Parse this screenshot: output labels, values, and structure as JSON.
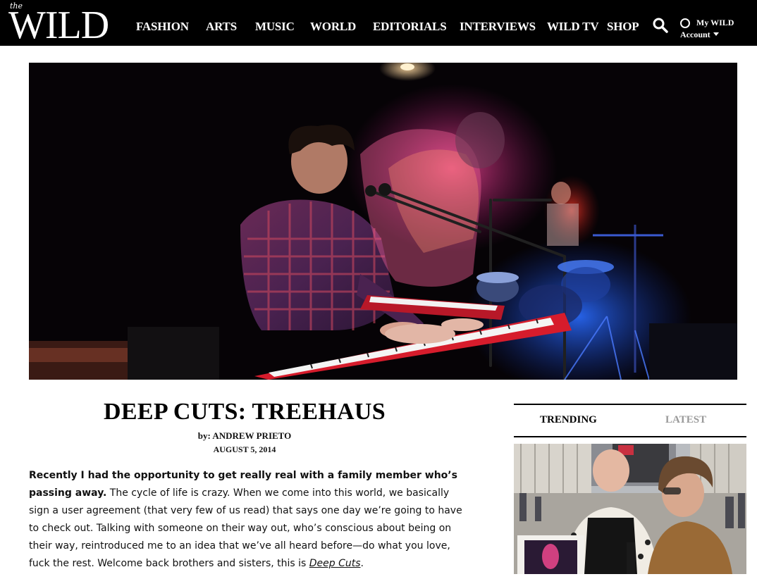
{
  "header": {
    "logo_small": "the",
    "logo_big": "WILD",
    "nav": [
      "FASHION",
      "ARTS",
      "MUSIC",
      "WORLD",
      "EDITORIALS",
      "INTERVIEWS",
      "WILD TV",
      "SHOP"
    ],
    "account_line1": "My WILD",
    "account_line2": "Account"
  },
  "article": {
    "title": "DEEP CUTS: TREEHAUS",
    "byline": "by: ANDREW PRIETO",
    "date": "AUGUST 5, 2014",
    "intro_bold": "Recently I had the opportunity to get really real with a family member who’s passing away.",
    "intro_rest": " The cycle of life is crazy. When we come into this world, we basically sign a user agreement (that very few of us read) that says one day we’re going to have to check out. Talking with someone on their way out, who’s conscious about being on their way, reintroduced me to an idea that we’ve all heard before—do what you love, fuck the rest. Welcome back brothers and sisters, this is ",
    "intro_link": "Deep Cuts",
    "intro_end": "."
  },
  "sidebar": {
    "tab_trending": "TRENDING",
    "tab_latest": "LATEST"
  },
  "colors": {
    "header_bg": "#000000",
    "tab_active": "#000000",
    "tab_inactive": "#999999"
  },
  "icons": [
    "search-icon",
    "account-icon",
    "chevron-down-icon"
  ]
}
